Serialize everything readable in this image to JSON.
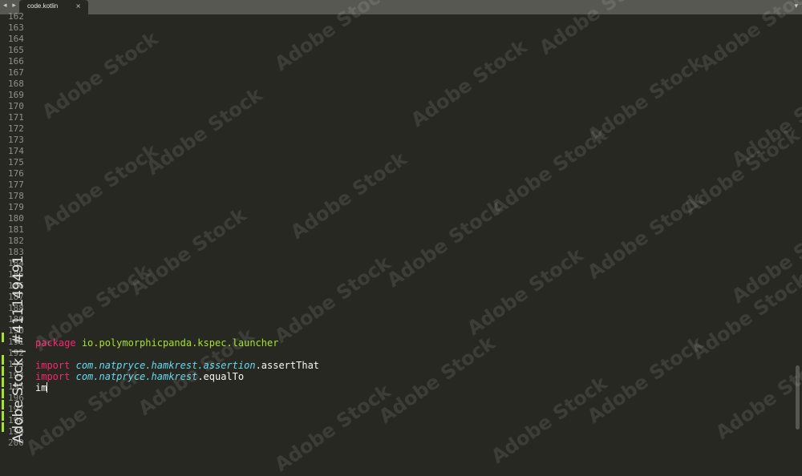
{
  "tab": {
    "label": "code.kotlin",
    "close": "×",
    "nav_arrows": "◂ ▸",
    "overflow": "▾"
  },
  "gutter": {
    "line_numbers": [
      "162",
      "163",
      "164",
      "165",
      "166",
      "167",
      "168",
      "169",
      "170",
      "171",
      "172",
      "173",
      "174",
      "175",
      "176",
      "177",
      "178",
      "179",
      "180",
      "181",
      "182",
      "183",
      "184",
      "185",
      "186",
      "187",
      "188",
      "189",
      "190",
      "191",
      "192",
      "193",
      "194",
      "195",
      "196",
      "197",
      "198",
      "199",
      "200"
    ]
  },
  "code": {
    "package_kw": "package",
    "package_name": "io.polymorphicpanda.kspec.launcher",
    "import_kw": "import",
    "import1_pkg": "com.natpryce.hamkrest.assertion",
    "import1_member": ".assertThat",
    "import2_pkg": "com.natpryce.hamkrest",
    "import2_member": ".equalTo",
    "typing": "im"
  },
  "watermark": {
    "text": "Adobe Stock",
    "id_text": "Adobe Stock | #411149491"
  },
  "colors": {
    "background": "#272822",
    "keyword": "#f92672",
    "string": "#a6e22e",
    "namespace": "#66d9ef"
  }
}
